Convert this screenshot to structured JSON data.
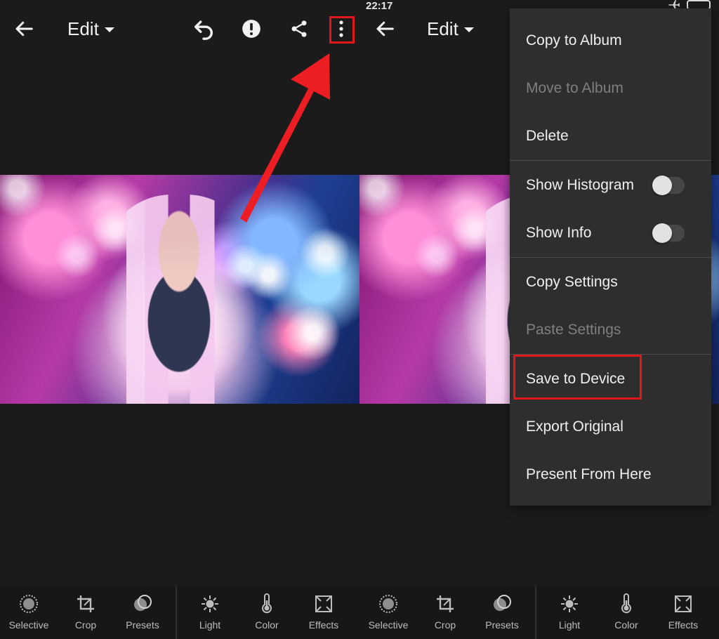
{
  "status_bar": {
    "time": "22:17"
  },
  "left": {
    "topbar": {
      "edit_label": "Edit"
    },
    "bottom_tools": [
      {
        "label": "Selective",
        "icon": "selective-icon"
      },
      {
        "label": "Crop",
        "icon": "crop-icon"
      },
      {
        "label": "Presets",
        "icon": "presets-icon"
      },
      {
        "label": "Light",
        "icon": "light-icon"
      },
      {
        "label": "Color",
        "icon": "color-icon"
      },
      {
        "label": "Effects",
        "icon": "effects-icon"
      }
    ]
  },
  "right": {
    "topbar": {
      "edit_label": "Edit"
    },
    "bottom_tools": [
      {
        "label": "Selective",
        "icon": "selective-icon"
      },
      {
        "label": "Crop",
        "icon": "crop-icon"
      },
      {
        "label": "Presets",
        "icon": "presets-icon"
      },
      {
        "label": "Light",
        "icon": "light-icon"
      },
      {
        "label": "Color",
        "icon": "color-icon"
      },
      {
        "label": "Effects",
        "icon": "effects-icon"
      }
    ]
  },
  "menu": {
    "items": [
      {
        "label": "Copy to Album",
        "disabled": false
      },
      {
        "label": "Move to Album",
        "disabled": true
      },
      {
        "label": "Delete",
        "disabled": false
      },
      {
        "label": "Show Histogram",
        "disabled": false,
        "toggle": false
      },
      {
        "label": "Show Info",
        "disabled": false,
        "toggle": false
      },
      {
        "label": "Copy Settings",
        "disabled": false
      },
      {
        "label": "Paste Settings",
        "disabled": true
      },
      {
        "label": "Save to Device",
        "disabled": false
      },
      {
        "label": "Export Original",
        "disabled": false
      },
      {
        "label": "Present From Here",
        "disabled": false
      }
    ]
  },
  "colors": {
    "background": "#1b1b1b",
    "menu_background": "#2e2e2e",
    "highlight_red": "#e0181c"
  }
}
